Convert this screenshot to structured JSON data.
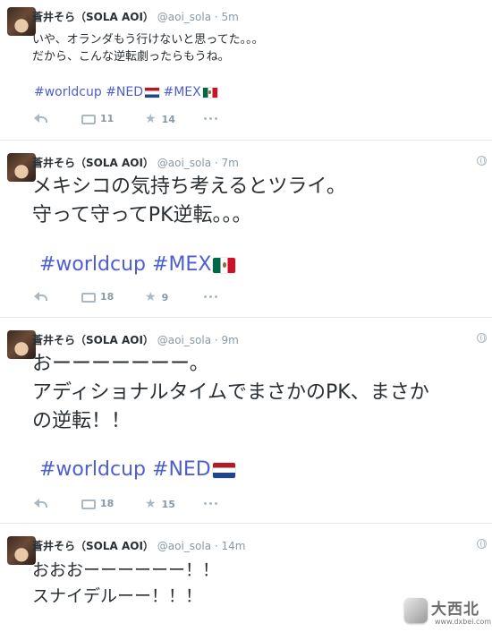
{
  "tweets": [
    {
      "name": "蒼井そら（SOLA AOI）",
      "handle": "@aoi_sola",
      "time": "· 5m",
      "lines": [
        "いや、オランダもう行けないと思ってた。。。",
        "だから、こんな逆転劇ったらもうね。"
      ],
      "tags": [
        "#worldcup",
        "#NED",
        "#MEX"
      ],
      "retweets": "11",
      "favorites": "14"
    },
    {
      "name": "蒼井そら（SOLA AOI）",
      "handle": "@aoi_sola",
      "time": "· 7m",
      "lines": [
        "メキシコの気持ち考えるとツライ。",
        "守って守ってPK逆転。。。"
      ],
      "tags": [
        "#worldcup",
        "#MEX"
      ],
      "retweets": "18",
      "favorites": "9"
    },
    {
      "name": "蒼井そら（SOLA AOI）",
      "handle": "@aoi_sola",
      "time": "· 9m",
      "lines": [
        "おーーーーーーー。",
        "アディショナルタイムでまさかのPK、まさか",
        "の逆転！！"
      ],
      "tags": [
        "#worldcup",
        "#NED"
      ],
      "retweets": "18",
      "favorites": "15"
    },
    {
      "name": "蒼井そら（SOLA AOI）",
      "handle": "@aoi_sola",
      "time": "· 14m",
      "lines": [
        "おおおーーーーーー！！",
        "スナイデルーー！！！"
      ]
    }
  ],
  "icons": {
    "reply": "reply-icon",
    "retweet": "retweet-icon",
    "favorite": "star-icon",
    "more": "more-icon",
    "globe": "globe-icon"
  },
  "colors": {
    "hashtag": "#4d5fcf",
    "meta": "#8899a6",
    "divider": "#e1e8ed"
  },
  "watermark": {
    "name": "大西北",
    "url": "www.dxbei.com"
  }
}
